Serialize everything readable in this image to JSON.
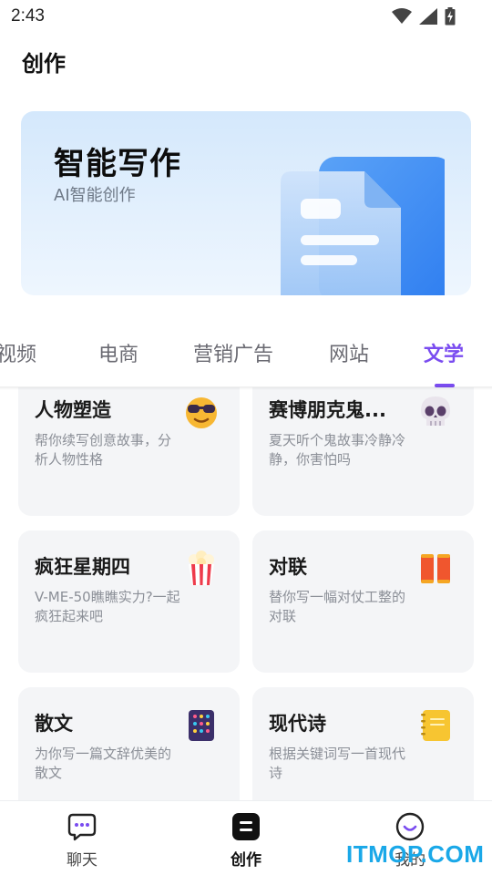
{
  "status_bar": {
    "time": "2:43"
  },
  "header": {
    "title": "创作"
  },
  "banner": {
    "title": "智能写作",
    "subtitle": "AI智能创作"
  },
  "tabs": [
    {
      "label": "短视频",
      "active": false
    },
    {
      "label": "电商",
      "active": false
    },
    {
      "label": "营销广告",
      "active": false
    },
    {
      "label": "网站",
      "active": false
    },
    {
      "label": "文学",
      "active": true
    }
  ],
  "cards": [
    {
      "title": "人物塑造",
      "description": "帮你续写创意故事，分析人物性格",
      "icon": "sunglasses-face-icon"
    },
    {
      "title": "赛博朋克鬼...",
      "description": "夏天听个鬼故事冷静冷静，你害怕吗",
      "icon": "skull-icon"
    },
    {
      "title": "疯狂星期四",
      "description": "V-ME-50瞧瞧实力?一起疯狂起来吧",
      "icon": "popcorn-icon"
    },
    {
      "title": "对联",
      "description": "替你写一幅对仗工整的对联",
      "icon": "couplet-scroll-icon"
    },
    {
      "title": "散文",
      "description": "为你写一篇文辞优美的散文",
      "icon": "notebook-icon"
    },
    {
      "title": "现代诗",
      "description": "根据关键词写一首现代诗",
      "icon": "notepad-icon"
    }
  ],
  "bottom_nav": [
    {
      "label": "聊天",
      "icon": "chat-bubble-icon",
      "active": false
    },
    {
      "label": "创作",
      "icon": "create-icon",
      "active": true
    },
    {
      "label": "我的",
      "icon": "profile-icon",
      "active": false
    }
  ],
  "watermark": "ITMOP.COM",
  "colors": {
    "accent": "#7a4cf0",
    "card_bg": "#f4f5f7",
    "banner_bg": "#d4e8fc"
  }
}
